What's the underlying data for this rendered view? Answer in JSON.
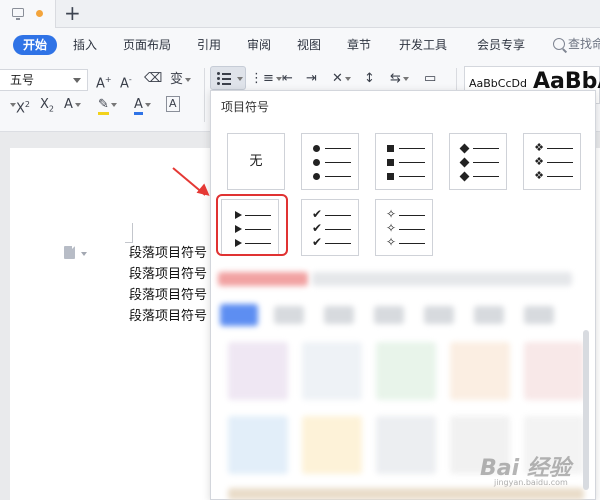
{
  "menu": {
    "items": [
      "开始",
      "插入",
      "页面布局",
      "引用",
      "审阅",
      "视图",
      "章节",
      "开发工具",
      "会员专享"
    ],
    "active": "开始",
    "search_label": "查找命"
  },
  "ribbon": {
    "font_size_value": "五号",
    "style_preview_1": "AaBbCcDd",
    "style_preview_2": "AaBbA"
  },
  "bullet_panel": {
    "title": "项目符号",
    "none_label": "无",
    "selected": "arrow",
    "options": [
      "none",
      "circle",
      "square",
      "diamond",
      "diamond-cluster",
      "arrow",
      "check",
      "star"
    ]
  },
  "document": {
    "paragraphs": [
      "段落项目符号",
      "段落项目符号",
      "段落项目符号",
      "段落项目符号"
    ]
  },
  "watermark": {
    "text": "Bai 经验",
    "sub": "jingyan.baidu.com"
  },
  "colors": {
    "accent": "#2f73e6",
    "highlight": "#e03232"
  }
}
